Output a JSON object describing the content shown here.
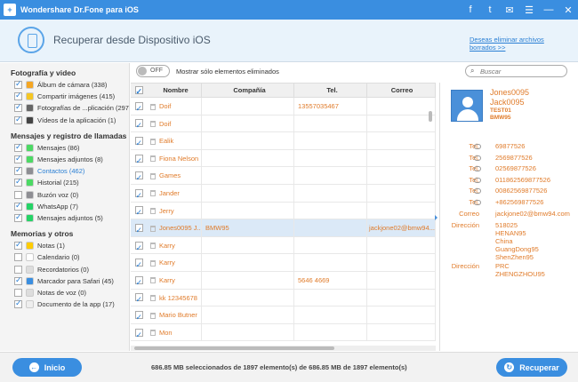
{
  "window": {
    "title": "Wondershare Dr.Fone para iOS",
    "controls": [
      "f",
      "t",
      "✉",
      "☰",
      "—",
      "✕"
    ]
  },
  "header": {
    "title": "Recuperar desde Dispositivo iOS",
    "link": "Deseas eliminar archivos borrados >>"
  },
  "sidebar": {
    "sections": [
      {
        "title": "Fotografía y video",
        "items": [
          {
            "label": "Álbum de cámara (338)",
            "checked": true,
            "color": "#f5a623"
          },
          {
            "label": "Compartir imágenes (415)",
            "checked": true,
            "color": "#f5c623"
          },
          {
            "label": "Fotografías de ...plicación (297)",
            "checked": true,
            "color": "#666666"
          },
          {
            "label": "Vídeos de la aplicación (1)",
            "checked": true,
            "color": "#444444"
          }
        ]
      },
      {
        "title": "Mensajes y registro de llamadas",
        "items": [
          {
            "label": "Mensajes (86)",
            "checked": true,
            "color": "#4cd964"
          },
          {
            "label": "Mensajes adjuntos (8)",
            "checked": true,
            "color": "#4cd964"
          },
          {
            "label": "Contactos (462)",
            "checked": true,
            "color": "#8e8e93",
            "active": true
          },
          {
            "label": "Historial (215)",
            "checked": true,
            "color": "#4cd964"
          },
          {
            "label": "Buzón voz (0)",
            "checked": false,
            "color": "#8e8e93"
          },
          {
            "label": "WhatsApp (7)",
            "checked": true,
            "color": "#25d366"
          },
          {
            "label": "Mensajes adjuntos (5)",
            "checked": true,
            "color": "#25d366"
          }
        ]
      },
      {
        "title": "Memorias y otros",
        "items": [
          {
            "label": "Notas (1)",
            "checked": true,
            "color": "#ffcc00"
          },
          {
            "label": "Calendario (0)",
            "checked": false,
            "color": "#ffffff"
          },
          {
            "label": "Recordatorios (0)",
            "checked": false,
            "color": "#dddddd"
          },
          {
            "label": "Marcador para Safari (45)",
            "checked": true,
            "color": "#3a8ee0"
          },
          {
            "label": "Notas de voz (0)",
            "checked": false,
            "color": "#dddddd"
          },
          {
            "label": "Documento de la app (17)",
            "checked": true,
            "color": "#eeeeee"
          }
        ]
      }
    ]
  },
  "toolbar": {
    "toggle": "OFF",
    "toggle_label": "Mostrar sólo elementos eliminados",
    "search_placeholder": "Buscar"
  },
  "table": {
    "headers": [
      "Nombre",
      "Compañía",
      "Tel.",
      "Correo"
    ],
    "rows": [
      {
        "name": "Doif",
        "company": "",
        "tel": "13557035467",
        "mail": ""
      },
      {
        "name": "Doif",
        "company": "",
        "tel": "",
        "mail": ""
      },
      {
        "name": "Ealik",
        "company": "",
        "tel": "",
        "mail": ""
      },
      {
        "name": "Fiona  Nelson",
        "company": "",
        "tel": "",
        "mail": ""
      },
      {
        "name": "Games",
        "company": "",
        "tel": "",
        "mail": ""
      },
      {
        "name": "Jander",
        "company": "",
        "tel": "",
        "mail": ""
      },
      {
        "name": "Jerry",
        "company": "",
        "tel": "",
        "mail": ""
      },
      {
        "name": "Jones0095  J...",
        "company": "BMW95",
        "tel": "",
        "mail": "jackjone02@bmw94...",
        "selected": true
      },
      {
        "name": "Karry",
        "company": "",
        "tel": "",
        "mail": ""
      },
      {
        "name": "Karry",
        "company": "",
        "tel": "",
        "mail": ""
      },
      {
        "name": "Karry",
        "company": "",
        "tel": "5646 4669",
        "mail": ""
      },
      {
        "name": "kk  12345678",
        "company": "",
        "tel": "",
        "mail": ""
      },
      {
        "name": "Mario  Butner",
        "company": "",
        "tel": "",
        "mail": ""
      },
      {
        "name": "Mon",
        "company": "",
        "tel": "",
        "mail": ""
      }
    ]
  },
  "detail": {
    "name1": "Jones0095",
    "name2": "Jack0095",
    "title": "TEST01",
    "company": "BMW95",
    "tel_label": "Tel.",
    "phones": [
      "69877526",
      "2569877526",
      "02569877526",
      "011862569877526",
      "00862569877526",
      "+862569877526"
    ],
    "mail_label": "Correo",
    "mail": "jackjone02@bmw94.com",
    "addr_label": "Dirección",
    "address": [
      "518025",
      "HENAN95",
      "China",
      "GuangDong95",
      "ShenZhen95"
    ],
    "addr2_label": "Dirección",
    "address2": [
      "PRC",
      "ZHENGZHOU95"
    ]
  },
  "footer": {
    "home": "Inicio",
    "status": "686.85 MB seleccionados de 1897 elemento(s) de 686.85 MB de 1897 elemento(s)",
    "recover": "Recuperar"
  }
}
